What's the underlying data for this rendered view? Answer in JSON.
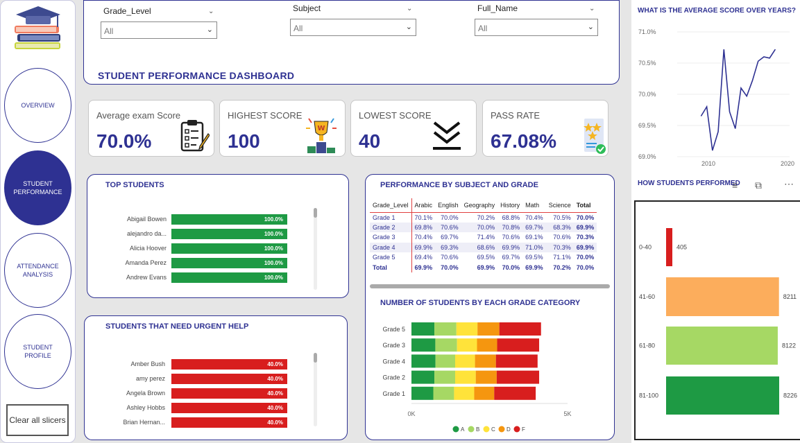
{
  "nav": {
    "items": [
      "OVERVIEW",
      "STUDENT PERFORMANCE",
      "ATTENDANCE ANALYSIS",
      "STUDENT PROFILE"
    ],
    "clear_label": "Clear all slicers"
  },
  "slicers": [
    {
      "label": "Grade_Level",
      "value": "All"
    },
    {
      "label": "Subject",
      "value": "All"
    },
    {
      "label": "Full_Name",
      "value": "All"
    }
  ],
  "title": "STUDENT PERFORMANCE DASHBOARD",
  "kpis": [
    {
      "label": "Average exam Score",
      "value": "70.0%",
      "icon": "clipboard-icon"
    },
    {
      "label": "HIGHEST SCORE",
      "value": "100",
      "icon": "trophy-icon"
    },
    {
      "label": "LOWEST SCORE",
      "value": "40",
      "icon": "double-chevron-down-icon"
    },
    {
      "label": "PASS RATE",
      "value": "67.08%",
      "icon": "certificate-icon"
    }
  ],
  "top_students": {
    "title": "TOP STUDENTS",
    "rows": [
      {
        "name": "Abigail Bowen",
        "value": "100.0%",
        "pct": 100
      },
      {
        "name": "alejandro da...",
        "value": "100.0%",
        "pct": 100
      },
      {
        "name": "Alicia Hoover",
        "value": "100.0%",
        "pct": 100
      },
      {
        "name": "Amanda Perez",
        "value": "100.0%",
        "pct": 100
      },
      {
        "name": "Andrew Evans",
        "value": "100.0%",
        "pct": 100
      }
    ]
  },
  "urgent_students": {
    "title": "STUDENTS THAT NEED URGENT HELP",
    "rows": [
      {
        "name": "Amber Bush",
        "value": "40.0%",
        "pct": 40
      },
      {
        "name": "amy perez",
        "value": "40.0%",
        "pct": 40
      },
      {
        "name": "Angela Brown",
        "value": "40.0%",
        "pct": 40
      },
      {
        "name": "Ashley Hobbs",
        "value": "40.0%",
        "pct": 40
      },
      {
        "name": "Brian Hernan...",
        "value": "40.0%",
        "pct": 40
      }
    ]
  },
  "perf_table": {
    "title": "PERFORMANCE BY SUBJECT AND GRADE",
    "headers": [
      "Grade_Level",
      "Arabic",
      "English",
      "Geography",
      "History",
      "Math",
      "Science",
      "Total"
    ],
    "rows": [
      [
        "Grade 1",
        "70.1%",
        "70.0%",
        "70.2%",
        "68.8%",
        "70.4%",
        "70.5%",
        "70.0%"
      ],
      [
        "Grade 2",
        "69.8%",
        "70.6%",
        "70.0%",
        "70.8%",
        "69.7%",
        "68.3%",
        "69.9%"
      ],
      [
        "Grade 3",
        "70.4%",
        "69.7%",
        "71.4%",
        "70.6%",
        "69.1%",
        "70.6%",
        "70.3%"
      ],
      [
        "Grade 4",
        "69.9%",
        "69.3%",
        "68.6%",
        "69.9%",
        "71.0%",
        "70.3%",
        "69.9%"
      ],
      [
        "Grade 5",
        "69.4%",
        "70.6%",
        "69.5%",
        "69.7%",
        "69.5%",
        "71.1%",
        "70.0%"
      ],
      [
        "Total",
        "69.9%",
        "70.0%",
        "69.9%",
        "70.0%",
        "69.9%",
        "70.2%",
        "70.0%"
      ]
    ]
  },
  "chart_data": [
    {
      "type": "bar",
      "title": "NUMBER OF STUDENTS BY EACH GRADE CATEGORY",
      "orientation": "horizontal-stacked",
      "categories": [
        "Grade 5",
        "Grade 3",
        "Grade 4",
        "Grade 2",
        "Grade 1"
      ],
      "series": [
        {
          "name": "A",
          "color": "#1e9a44",
          "values": [
            735,
            765,
            770,
            735,
            700
          ]
        },
        {
          "name": "B",
          "color": "#a6d864",
          "values": [
            705,
            695,
            630,
            665,
            665
          ]
        },
        {
          "name": "C",
          "color": "#ffe33a",
          "values": [
            675,
            640,
            635,
            660,
            645
          ]
        },
        {
          "name": "D",
          "color": "#f5960f",
          "values": [
            700,
            645,
            670,
            670,
            640
          ]
        },
        {
          "name": "F",
          "color": "#d81e1e",
          "values": [
            1335,
            1345,
            1335,
            1360,
            1330
          ]
        }
      ],
      "xticks": [
        "0K",
        "5K"
      ],
      "xlim": [
        0,
        5000
      ]
    },
    {
      "type": "line",
      "title": "WHAT IS THE AVERAGE SCORE OVER YEARS?",
      "x": [
        2005,
        2006,
        2007,
        2008,
        2009,
        2010,
        2011,
        2012,
        2013,
        2014,
        2015,
        2016,
        2017,
        2018,
        2019
      ],
      "y": [
        69.65,
        69.8,
        69.1,
        69.4,
        70.72,
        69.72,
        69.45,
        70.1,
        69.97,
        70.22,
        70.53,
        70.6,
        70.58,
        70.72
      ],
      "ylim": [
        69.0,
        71.0
      ],
      "yticks": [
        "71.0%",
        "70.5%",
        "70.0%",
        "69.5%",
        "69.0%"
      ],
      "xticks": [
        "2010",
        "2020"
      ]
    },
    {
      "type": "bar",
      "title": "HOW STUDENTS PERFORMED",
      "orientation": "horizontal",
      "categories": [
        "0-40",
        "41-60",
        "61-80",
        "81-100"
      ],
      "values": [
        405,
        8211,
        8122,
        8226
      ],
      "value_labels": [
        "405",
        "8211",
        "8122",
        "8226"
      ],
      "colors": [
        "#d81e1e",
        "#fcad5c",
        "#a6d864",
        "#1e9a44"
      ]
    }
  ]
}
